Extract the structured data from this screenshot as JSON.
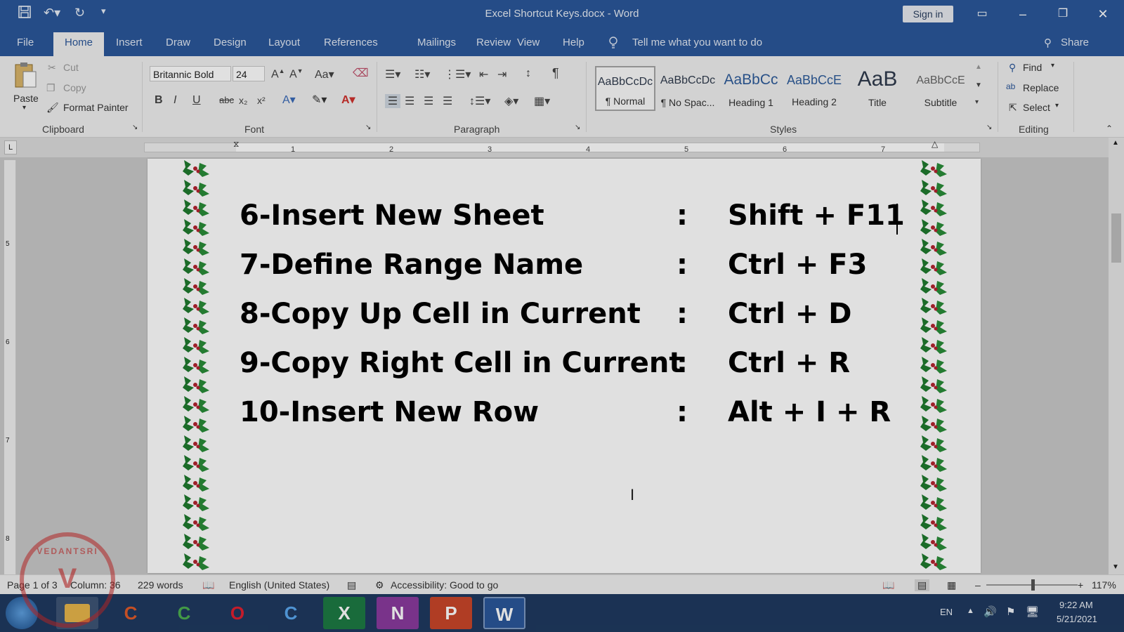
{
  "title_bar": {
    "document_title": "Excel Shortcut Keys.docx  -  Word",
    "sign_in": "Sign in",
    "quick_access": [
      "save-icon",
      "undo-icon",
      "redo-icon",
      "customize-icon"
    ]
  },
  "tabs": {
    "items": [
      "File",
      "Home",
      "Insert",
      "Draw",
      "Design",
      "Layout",
      "References",
      "Mailings",
      "Review",
      "View",
      "Help"
    ],
    "active": "Home",
    "tell_me": "Tell me what you want to do",
    "share": "Share"
  },
  "ribbon": {
    "clipboard": {
      "paste": "Paste",
      "cut": "Cut",
      "copy": "Copy",
      "format_painter": "Format Painter",
      "label": "Clipboard"
    },
    "font": {
      "font_name": "Britannic Bold",
      "font_size": "24",
      "label": "Font",
      "buttons": [
        "B",
        "I",
        "U",
        "abc",
        "x₂",
        "x²"
      ]
    },
    "paragraph": {
      "label": "Paragraph"
    },
    "styles": {
      "label": "Styles",
      "items": [
        {
          "preview": "AaBbCcDc",
          "name": "¶ Normal"
        },
        {
          "preview": "AaBbCcDc",
          "name": "¶ No Spac..."
        },
        {
          "preview": "AaBbCc",
          "name": "Heading 1"
        },
        {
          "preview": "AaBbCcE",
          "name": "Heading 2"
        },
        {
          "preview": "AaB",
          "name": "Title"
        },
        {
          "preview": "AaBbCcE",
          "name": "Subtitle"
        }
      ]
    },
    "editing": {
      "find": "Find",
      "replace": "Replace",
      "select": "Select",
      "label": "Editing"
    }
  },
  "ruler": {
    "numbers": [
      "1",
      "2",
      "3",
      "4",
      "5",
      "6",
      "7"
    ]
  },
  "document": {
    "rows": [
      {
        "label": "6-Insert New Sheet",
        "sep": ":",
        "keys": "Shift + F11"
      },
      {
        "label": "7-Define Range Name",
        "sep": ":",
        "keys": "Ctrl + F3"
      },
      {
        "label": "8-Copy Up Cell in Current",
        "sep": ":",
        "keys": "Ctrl + D"
      },
      {
        "label": "9-Copy Right Cell in Current",
        "sep": ":",
        "keys": "Ctrl + R"
      },
      {
        "label": "10-Insert New Row",
        "sep": ":",
        "keys": "Alt + I + R"
      }
    ]
  },
  "status_bar": {
    "page": "Page 1 of 3",
    "column": "Column: 36",
    "words": "229 words",
    "language": "English (United States)",
    "accessibility": "Accessibility: Good to go",
    "zoom": "117%"
  },
  "taskbar": {
    "apps": [
      "C",
      "C",
      "O",
      "C",
      "X",
      "N",
      "P",
      "W"
    ],
    "language": "EN",
    "time": "9:22 AM",
    "date": "5/21/2021"
  },
  "watermark": {
    "text": "VEDANTSRI"
  },
  "colors": {
    "word_blue": "#2b579a",
    "border_green": "#1f7a2e",
    "border_red": "#b3242f"
  }
}
